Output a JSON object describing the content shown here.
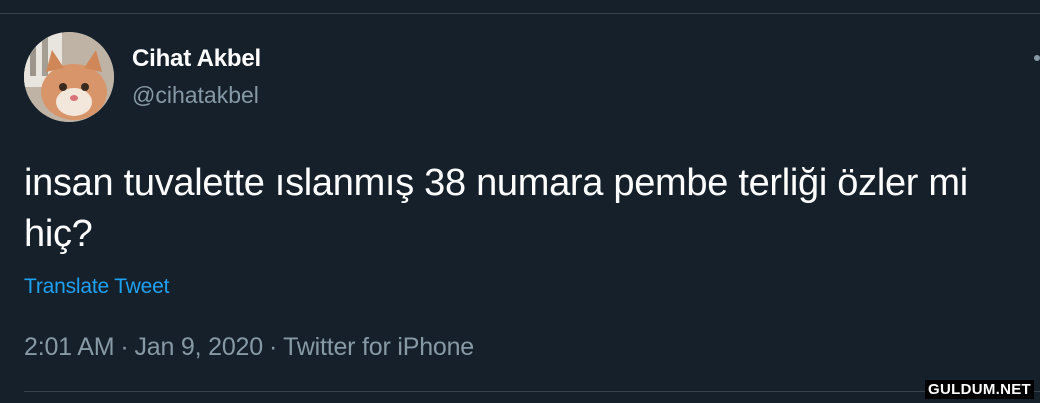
{
  "author": {
    "display_name": "Cihat Akbel",
    "handle": "@cihatakbel",
    "avatar_icon": "cat-avatar"
  },
  "tweet": {
    "text": "insan tuvalette ıslanmış 38 numara pembe terliği özler mi hiç?",
    "translate_label": "Translate Tweet",
    "time": "2:01 AM",
    "date": "Jan 9, 2020",
    "source": "Twitter for iPhone",
    "separator": "·"
  },
  "watermark": "GULDUM.NET",
  "colors": {
    "background": "#15202b",
    "primary_text": "#ffffff",
    "secondary_text": "#8899a6",
    "link": "#1da1f2",
    "divider": "#38444d"
  }
}
